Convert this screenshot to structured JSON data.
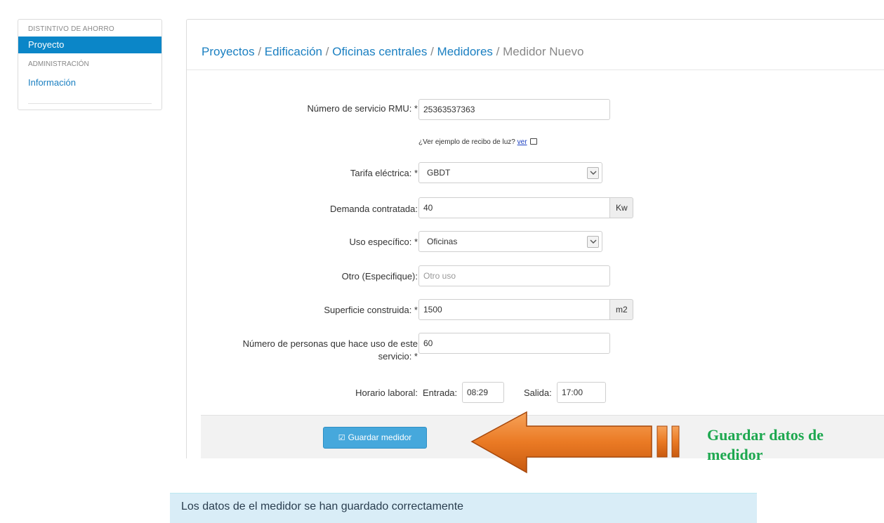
{
  "sidebar": {
    "section1": "DISTINTIVO DE AHORRO",
    "active_item": "Proyecto",
    "section2": "ADMINISTRACIÓN",
    "item2": "Información"
  },
  "breadcrumb": {
    "items": [
      "Proyectos",
      "Edificación",
      "Oficinas centrales",
      "Medidores"
    ],
    "separator": "/",
    "current": "Medidor Nuevo"
  },
  "form": {
    "rmu_label": "Número de servicio RMU: *",
    "rmu_value": "25363537363",
    "receipt_note": "¿Ver ejemplo de recibo de luz?",
    "receipt_link": "ver",
    "tarifa_label": "Tarifa eléctrica: *",
    "tarifa_value": "GBDT",
    "demanda_label": "Demanda contratada:",
    "demanda_value": "40",
    "demanda_unit": "Kw",
    "uso_label": "Uso específico: *",
    "uso_value": "Oficinas",
    "otro_label": "Otro (Especifique):",
    "otro_placeholder": "Otro uso",
    "superficie_label": "Superficie construida: *",
    "superficie_value": "1500",
    "superficie_unit": "m2",
    "personas_label_line1": "Número de personas que hace uso de este",
    "personas_label_line2": "servicio: *",
    "personas_value": "60",
    "horario_label": "Horario laboral:",
    "entrada_label": "Entrada:",
    "entrada_value": "08:29",
    "salida_label": "Salida:",
    "salida_value": "17:00"
  },
  "save_button": "Guardar medidor",
  "annotation": "Guardar datos de medidor",
  "alert": "Los datos de el medidor se han guardado correctamente",
  "colors": {
    "primary": "#0b86c8",
    "button": "#46a8dc",
    "arrow": "#e8731f",
    "annotation_text": "#1ea850",
    "alert_bg": "#d9edf7"
  }
}
